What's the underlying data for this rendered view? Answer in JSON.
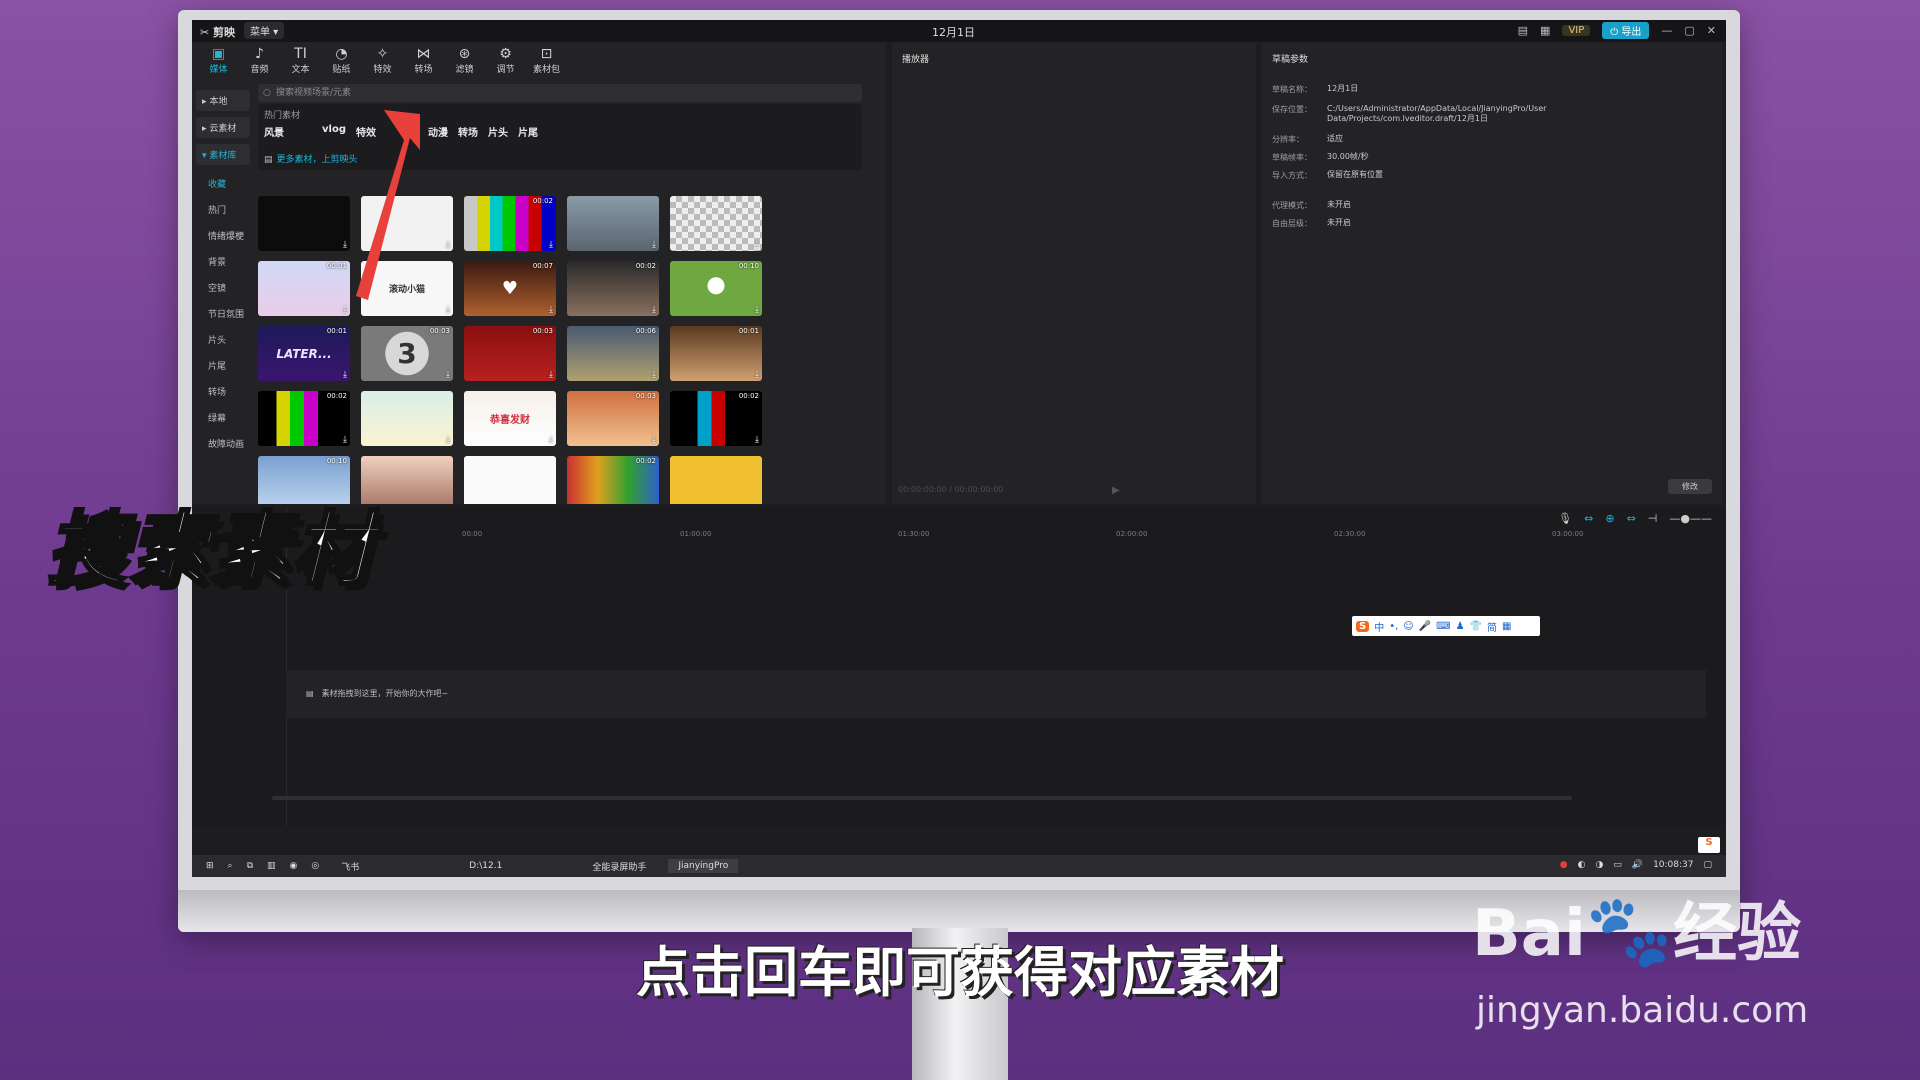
{
  "titlebar": {
    "app": "✂ 剪映",
    "menu": "菜单 ▾",
    "project": "12月1日",
    "vip": "VIP",
    "export": "⏻ 导出",
    "controls": [
      "—",
      "▢",
      "✕"
    ]
  },
  "toolbar": [
    {
      "label": "媒体",
      "icon": "▣"
    },
    {
      "label": "音频",
      "icon": "♪"
    },
    {
      "label": "文本",
      "icon": "TI"
    },
    {
      "label": "贴纸",
      "icon": "◔"
    },
    {
      "label": "特效",
      "icon": "✧"
    },
    {
      "label": "转场",
      "icon": "⋈"
    },
    {
      "label": "滤镜",
      "icon": "⊛"
    },
    {
      "label": "调节",
      "icon": "⚙"
    },
    {
      "label": "素材包",
      "icon": "⊡"
    }
  ],
  "sidenav": {
    "local": "▸ 本地",
    "cloud": "▸ 云素材",
    "library": "▾ 素材库",
    "items": [
      "收藏",
      "热门",
      "情绪爆梗",
      "背景",
      "空镜",
      "节日氛围",
      "片头",
      "片尾",
      "转场",
      "绿幕",
      "故障动画"
    ]
  },
  "search": {
    "placeholder": "搜索视频场景/元素"
  },
  "hot": {
    "title": "热门素材",
    "tags": [
      "风景",
      "",
      "vlog",
      "特效",
      "",
      "动漫",
      "转场",
      "片头",
      "片尾"
    ],
    "hint": "更多素材，上剪映头"
  },
  "thumbs": [
    {
      "dur": "",
      "bg": "#0c0c0c",
      "text": ""
    },
    {
      "dur": "",
      "bg": "#f2f2f2",
      "text": ""
    },
    {
      "dur": "00:02",
      "bg": "linear-gradient(90deg,#c8c8c8 0 14%,#d6d400 14% 28%,#00c8c8 28% 42%,#00c800 42% 56%,#c800c8 56% 70%,#c80000 70% 84%,#0000c8 84%)",
      "text": ""
    },
    {
      "dur": "",
      "bg": "linear-gradient(#8a9aa8,#5a6570)",
      "text": ""
    },
    {
      "dur": "",
      "bg": "repeating-conic-gradient(#bbb 0 25%,#eee 0 50%) 0 0/12px 12px",
      "text": ""
    },
    {
      "dur": "00:01",
      "bg": "linear-gradient(#cfd8f5,#e9cde9)",
      "text": ""
    },
    {
      "dur": "",
      "bg": "#f7f7f7",
      "text": "滚动小猫"
    },
    {
      "dur": "00:07",
      "bg": "linear-gradient(#3a1a10,#b06030)",
      "text": "♥"
    },
    {
      "dur": "00:02",
      "bg": "linear-gradient(#2a2a2a,#8a7060)",
      "text": ""
    },
    {
      "dur": "00:10",
      "bg": "radial-gradient(circle at 50% 45%,#fff 0 15%,#6fa840 16% 100%)",
      "text": ""
    },
    {
      "dur": "00:01",
      "bg": "linear-gradient(#1d1a5a,#3a1570)",
      "text": "LATER..."
    },
    {
      "dur": "00:03",
      "bg": "radial-gradient(circle,#d8d8d8 0 40%,#7a7a7a 41% 100%)",
      "text": "3"
    },
    {
      "dur": "00:03",
      "bg": "linear-gradient(#8a1010,#b82020)",
      "text": ""
    },
    {
      "dur": "00:06",
      "bg": "linear-gradient(#4a5a70,#b0a070)",
      "text": ""
    },
    {
      "dur": "00:01",
      "bg": "linear-gradient(#5a3a20,#d0a070)",
      "text": ""
    },
    {
      "dur": "00:02",
      "bg": "linear-gradient(90deg,#000 0 20%,#d6d400 20% 35%,#00c800 35% 50%,#c800c8 50% 65%,#000 65%)",
      "text": ""
    },
    {
      "dur": "",
      "bg": "linear-gradient(#d8f0e8,#fbf3d0)",
      "text": ""
    },
    {
      "dur": "",
      "bg": "linear-gradient(#f5f0e8,#fff)",
      "text": "恭喜发财"
    },
    {
      "dur": "00:03",
      "bg": "linear-gradient(#d07040,#f0c090)",
      "text": ""
    },
    {
      "dur": "00:02",
      "bg": "linear-gradient(90deg,#000 0 30%,#00a0c8 30% 45%,#c80000 45% 60%,#000 60%)",
      "text": ""
    },
    {
      "dur": "00:10",
      "bg": "linear-gradient(#7aa0d0,#c0d8f0)",
      "text": ""
    },
    {
      "dur": "",
      "bg": "linear-gradient(#f0d0c0,#a07060)",
      "text": ""
    },
    {
      "dur": "",
      "bg": "#fafafa",
      "text": ""
    },
    {
      "dur": "00:02",
      "bg": "linear-gradient(90deg,#c83030,#e0a020,#30a030,#3060c8)",
      "text": ""
    },
    {
      "dur": "",
      "bg": "#f0c030",
      "text": ""
    }
  ],
  "player": {
    "title": "播放器",
    "time": "00:00:00:00 / 00:00:00:00"
  },
  "params": {
    "title": "草稿参数",
    "rows": [
      {
        "k": "草稿名称：",
        "v": "12月1日"
      },
      {
        "k": "保存位置：",
        "v": "C:/Users/Administrator/AppData/Local/JianyingPro/User Data/Projects/com.lveditor.draft/12月1日"
      },
      {
        "k": "分辨率：",
        "v": "适应"
      },
      {
        "k": "草稿帧率：",
        "v": "30.00帧/秒"
      },
      {
        "k": "导入方式：",
        "v": "保留在原有位置"
      },
      {
        "k": "代理模式：",
        "v": "未开启"
      },
      {
        "k": "自由层级：",
        "v": "未开启"
      }
    ],
    "modify": "修改"
  },
  "timeline": {
    "ruler": [
      "00:00",
      "01:00:00",
      "01:30:00",
      "02:00:00",
      "02:30:00",
      "03:00:00"
    ],
    "hint": "素材拖拽到这里，开始你的大作吧~"
  },
  "ime": {
    "s": "S",
    "items": [
      "中",
      "•,",
      "☺",
      "🎤",
      "⌨",
      "♟",
      "👕",
      "简",
      "▦"
    ]
  },
  "taskbar": {
    "items": [
      "飞书",
      "D:\\12.1",
      "全能录屏助手",
      "JianyingPro"
    ],
    "clock": "10:08:37"
  },
  "overlay": {
    "title": "搜索素材",
    "subtitle": "点击回车即可获得对应素材"
  },
  "watermark": {
    "brand": "Bai",
    "du": "du",
    "cn": "经验",
    "url": "jingyan.baidu.com"
  }
}
